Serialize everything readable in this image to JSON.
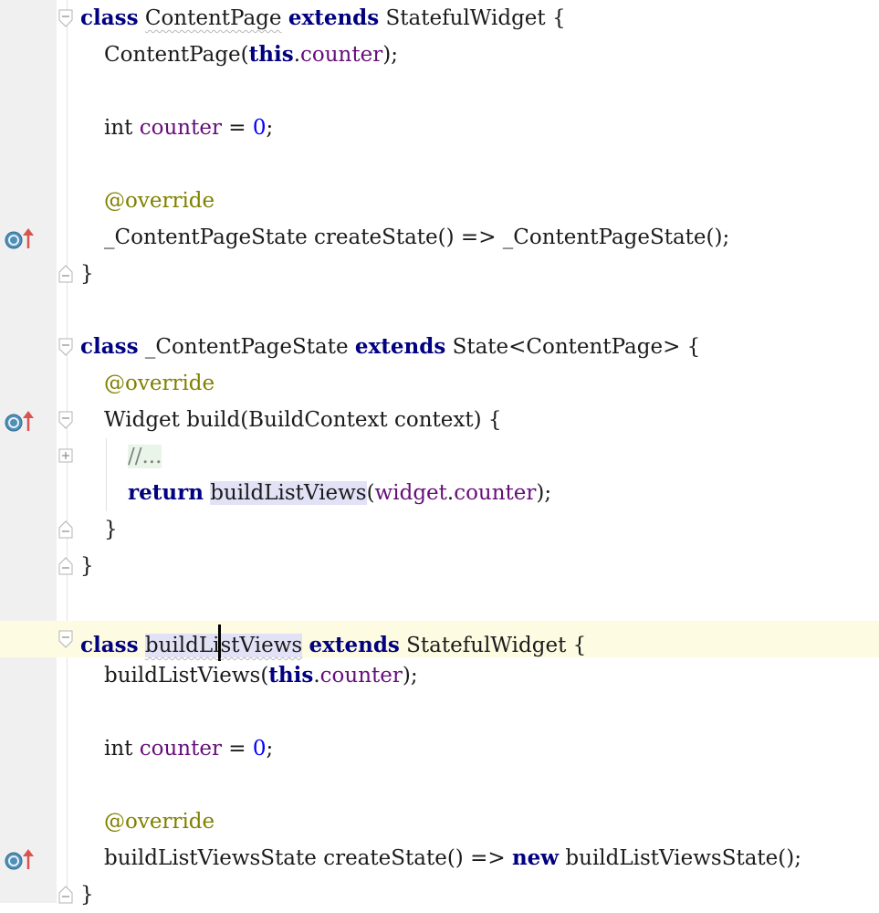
{
  "gutter": {
    "override_icon": "override-method-icon",
    "fold_icon": "fold-toggle-icon"
  },
  "colors": {
    "keyword": "#000080",
    "field": "#660e7a",
    "annotation": "#808000",
    "number": "#0000ff",
    "current_line": "#fdfbe2",
    "highlight": "#e2e2f7"
  },
  "code": {
    "kw_class": "class",
    "kw_extends": "extends",
    "kw_this": "this",
    "kw_return": "return",
    "kw_new": "new",
    "kw_int": "int",
    "ident_content_page": "ContentPage",
    "ident_stateful_widget": "StatefulWidget",
    "ident_content_page_state": "_ContentPageState",
    "ident_state_generic": "State<ContentPage>",
    "ident_widget": "Widget",
    "ident_build": "build",
    "ident_build_context": "BuildContext",
    "ident_context": "context",
    "ident_build_list_views": "buildListViews",
    "ident_build_list_views_state": "buildListViewsState",
    "ident_create_state": "createState",
    "field_counter": "counter",
    "field_widget": "widget",
    "annotation_override": "@override",
    "number_zero": "0",
    "comment_folded": "//...",
    "punct_open_paren": "(",
    "punct_close_paren_semi": ");",
    "punct_dot": ".",
    "punct_equals": " = ",
    "punct_semicolon": ";",
    "punct_arrow": "() => ",
    "punct_call_semi": "();",
    "punct_open_brace": " {",
    "punct_close_brace": "}",
    "punct_build_args_open": " build(",
    "punct_build_args_close": " context) {",
    "space": " "
  }
}
